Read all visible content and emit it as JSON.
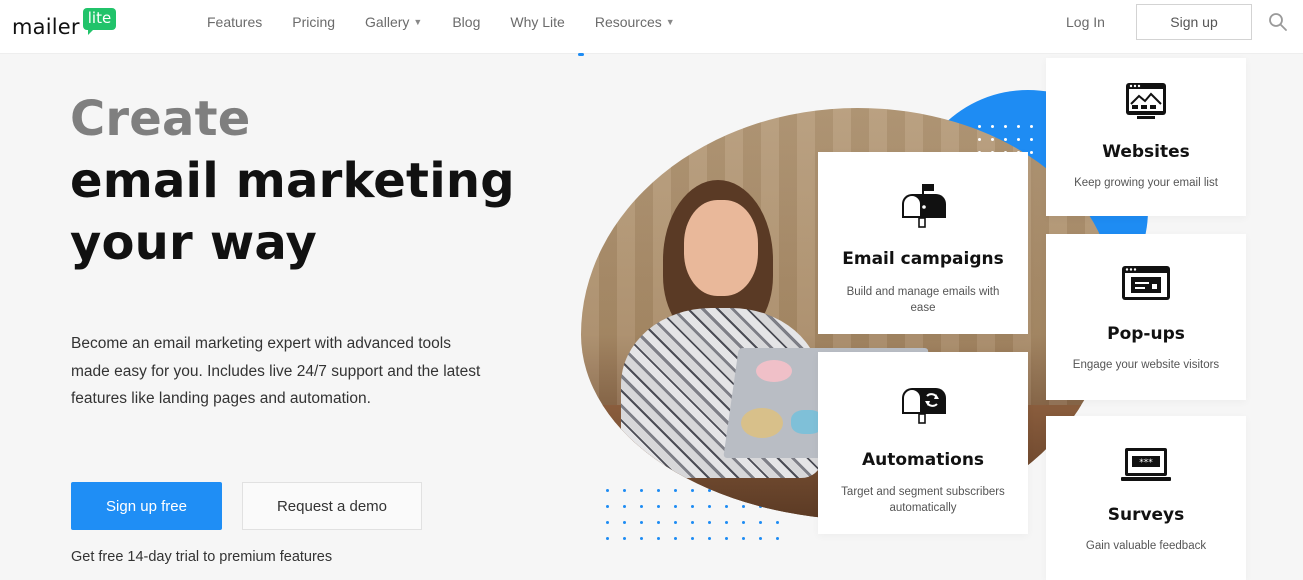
{
  "brand": {
    "name": "mailer",
    "badge": "lite",
    "colors": {
      "accent": "#1f8ef5",
      "green": "#21c36a"
    }
  },
  "nav": {
    "items": [
      {
        "label": "Features",
        "dropdown": false
      },
      {
        "label": "Pricing",
        "dropdown": false
      },
      {
        "label": "Gallery",
        "dropdown": true
      },
      {
        "label": "Blog",
        "dropdown": false
      },
      {
        "label": "Why Lite",
        "dropdown": false
      },
      {
        "label": "Resources",
        "dropdown": true
      }
    ],
    "login": "Log In",
    "signup": "Sign up",
    "search_icon": "search-icon"
  },
  "hero": {
    "title_line1": "Create",
    "title_line2": "email marketing",
    "title_line3": "your way",
    "description": "Become an email marketing expert with advanced tools made easy for you. Includes live 24/7 support and the latest features like landing pages and automation.",
    "primary_cta": "Sign up free",
    "secondary_cta": "Request a demo",
    "trial_note": "Get free 14-day trial to premium features"
  },
  "features": [
    {
      "key": "email",
      "title": "Email campaigns",
      "desc": "Build and manage emails with ease",
      "icon": "mailbox-icon"
    },
    {
      "key": "auto",
      "title": "Automations",
      "desc": "Target and segment subscribers automatically",
      "icon": "mailbox-sync-icon"
    },
    {
      "key": "web",
      "title": "Websites",
      "desc": "Keep growing your email list",
      "icon": "website-icon"
    },
    {
      "key": "pop",
      "title": "Pop-ups",
      "desc": "Engage your website visitors",
      "icon": "popup-window-icon"
    },
    {
      "key": "surv",
      "title": "Surveys",
      "desc": "Gain valuable feedback",
      "icon": "survey-laptop-icon"
    }
  ]
}
